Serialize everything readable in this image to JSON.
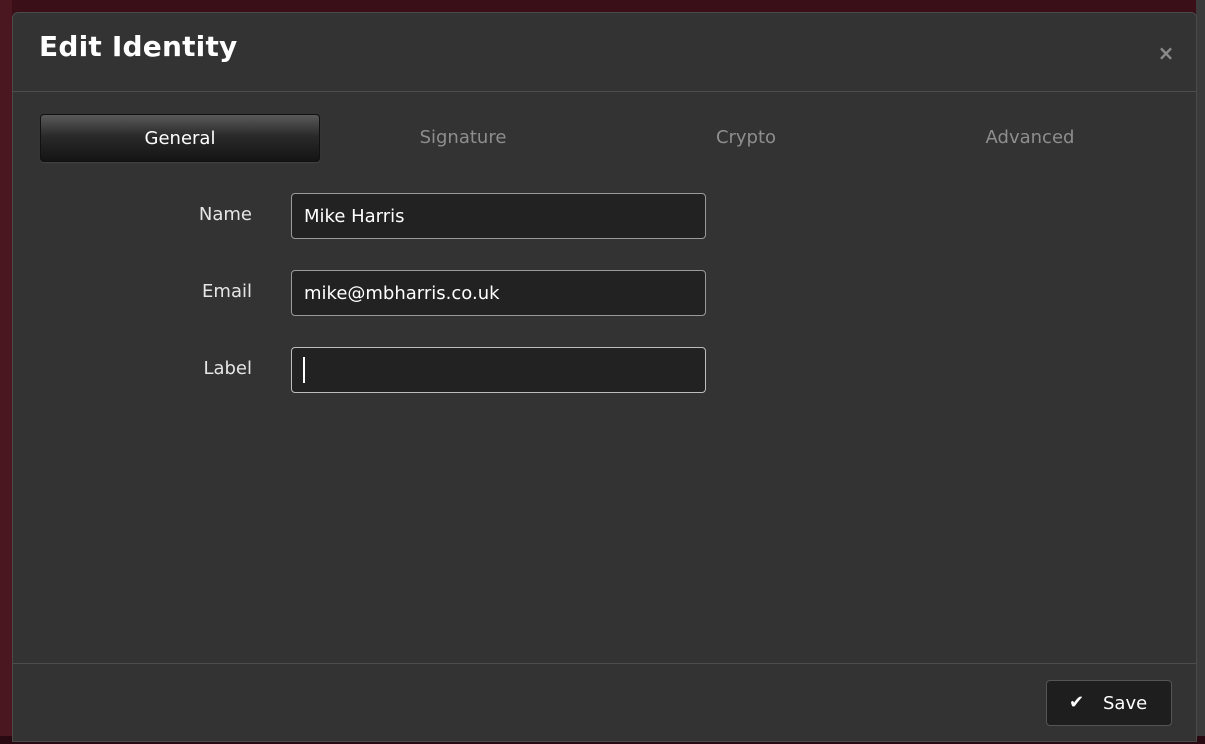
{
  "dialog": {
    "title": "Edit Identity",
    "close_icon": "×"
  },
  "tabs": [
    {
      "label": "General",
      "active": true
    },
    {
      "label": "Signature",
      "active": false
    },
    {
      "label": "Crypto",
      "active": false
    },
    {
      "label": "Advanced",
      "active": false
    }
  ],
  "form": {
    "name": {
      "label": "Name",
      "value": "Mike Harris"
    },
    "email": {
      "label": "Email",
      "value": "mike@mbharris.co.uk"
    },
    "label": {
      "label": "Label",
      "value": ""
    }
  },
  "footer": {
    "save_icon": "✔",
    "save_label": "Save"
  },
  "colors": {
    "modal_bg": "#333333",
    "input_bg": "#222222",
    "active_tab_text": "#ffffff",
    "inactive_tab_text": "#8e8e8e",
    "backdrop": "#3a0f18"
  }
}
